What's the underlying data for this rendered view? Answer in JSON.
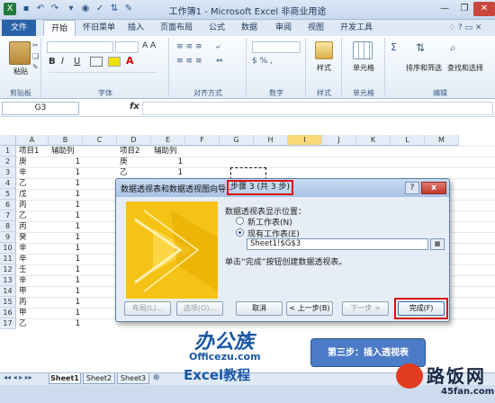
{
  "window": {
    "title": "工作簿1 - Microsoft Excel 非商业用途",
    "minimize_icon": "minimize-icon",
    "restore_icon": "restore-icon",
    "close_icon": "close-icon"
  },
  "ribbon_tabs": [
    "文件",
    "开始",
    "怀旧菜单",
    "插入",
    "页面布局",
    "公式",
    "数据",
    "审阅",
    "视图",
    "开发工具"
  ],
  "ribbon_groups": {
    "clipboard": {
      "label": "剪贴板",
      "paste": "粘贴"
    },
    "font": {
      "label": "字体"
    },
    "alignment": {
      "label": "对齐方式"
    },
    "number": {
      "label": "数字"
    },
    "styles": {
      "label": "样式",
      "button": "样式"
    },
    "cells": {
      "label": "单元格",
      "button": "单元格"
    },
    "editing": {
      "label": "编辑",
      "sort": "排序和筛选",
      "find": "查找和选择"
    }
  },
  "formula_bar": {
    "name_box": "G3",
    "fx": "fx",
    "value": ""
  },
  "columns": [
    "A",
    "B",
    "C",
    "D",
    "E",
    "F",
    "G",
    "H",
    "I",
    "J",
    "K",
    "L",
    "M"
  ],
  "rows": [
    "1",
    "2",
    "3",
    "4",
    "5",
    "6",
    "7",
    "8",
    "9",
    "10",
    "11",
    "12",
    "13",
    "14",
    "15",
    "16",
    "17"
  ],
  "cells_a": [
    "项目1",
    "庚",
    "辛",
    "乙",
    "戊",
    "丙",
    "乙",
    "丙",
    "癸",
    "辛",
    "辛",
    "壬",
    "辛",
    "甲",
    "丙",
    "甲",
    "乙"
  ],
  "cells_b": [
    "辅助列",
    "1",
    "1",
    "1",
    "1",
    "1",
    "1",
    "1",
    "1",
    "1",
    "1",
    "1",
    "1",
    "1",
    "1",
    "1",
    "1"
  ],
  "cells_d": [
    "项目2",
    "庚",
    "乙"
  ],
  "cells_e": [
    "辅助列",
    "1",
    "1"
  ],
  "dialog": {
    "title": "数据透视表和数据透视图向导 -",
    "step": "步骤 3 (共 3 步)",
    "help_icon": "?",
    "close_icon": "x",
    "question": "数据透视表显示位置：",
    "option_new": "新工作表(N)",
    "option_existing": "现有工作表(E)",
    "location_value": "Sheet1!$G$3",
    "hint": "单击“完成”按钮创建数据透视表。",
    "btn_layout": "布局(L)...",
    "btn_options": "选项(O)...",
    "btn_cancel": "取消",
    "btn_back": "< 上一步(B)",
    "btn_next": "下一步 >",
    "btn_finish": "完成(F)"
  },
  "sheet_tabs": [
    "Sheet1",
    "Sheet2",
    "Sheet3"
  ],
  "watermark": {
    "brand": "办公族",
    "site": "Officezu.com",
    "tutorial": "Excel教程"
  },
  "step_banner": "第三步：插入透视表",
  "site_logo": {
    "name": "路饭网",
    "url": "45fan.com"
  },
  "colors": {
    "accent": "#2a62a8",
    "dialog_highlight": "#dd1111",
    "wizard_art": "#f5c316",
    "banner": "#4c7bc7"
  }
}
